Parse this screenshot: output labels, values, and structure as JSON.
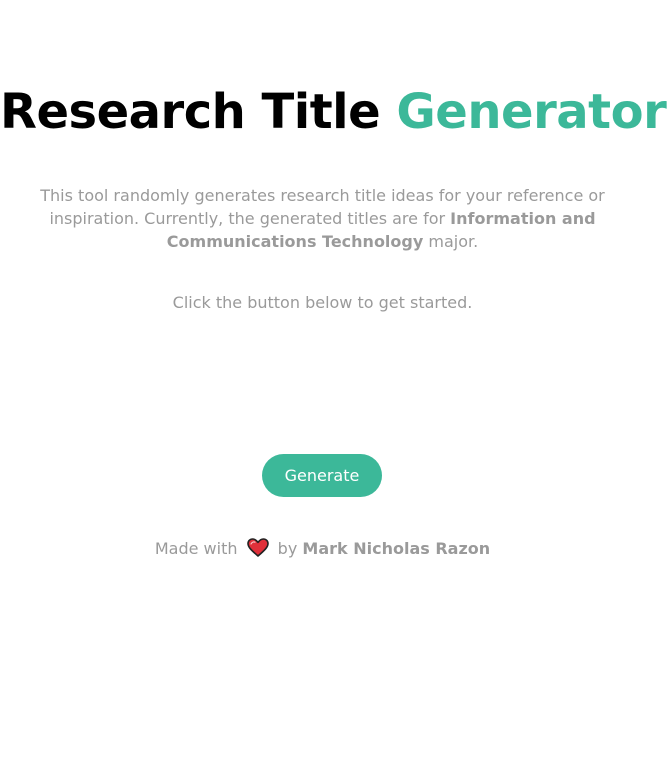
{
  "header": {
    "title_main": "Research Title",
    "title_accent": "Generator"
  },
  "intro": {
    "text_before": "This tool randomly generates research title ideas for your reference or inspiration. Currently, the generated titles are for ",
    "text_bold": "Information and Communications Technology",
    "text_after": " major."
  },
  "cta": {
    "text": "Click the button below to get started."
  },
  "actions": {
    "generate_label": "Generate"
  },
  "footer": {
    "made_with": "Made with",
    "heart_icon": "heart-icon",
    "by": "by",
    "author": "Mark Nicholas Razon"
  },
  "colors": {
    "accent": "#3cb899",
    "muted_text": "#9a9a9a",
    "title": "#000000",
    "heart": "#e0303a"
  }
}
